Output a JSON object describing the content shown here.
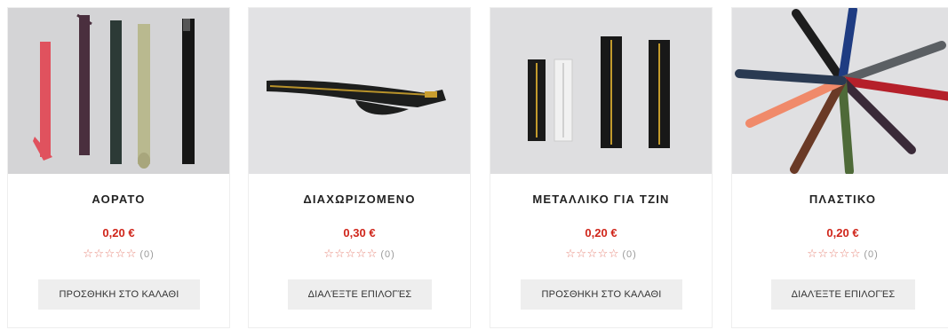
{
  "products": [
    {
      "title": "ΑΟΡΑΤΟ",
      "price": "0,20 €",
      "stars": "☆☆☆☆☆",
      "rating_count": "(0)",
      "button_label": "ΠΡΟΣΘΗΚΗ ΣΤΟ ΚΑΛΑΘΙ"
    },
    {
      "title": "ΔΙΑΧΩΡΙΖΟΜΕΝΟ",
      "price": "0,30 €",
      "stars": "☆☆☆☆☆",
      "rating_count": "(0)",
      "button_label": "ΔΙΑΛΈΞΤΕ ΕΠΙΛΟΓΈΣ"
    },
    {
      "title": "ΜΕΤΑΛΛΙΚΟ ΓΙΑ ΤΖΙΝ",
      "price": "0,20 €",
      "stars": "☆☆☆☆☆",
      "rating_count": "(0)",
      "button_label": "ΠΡΟΣΘΗΚΗ ΣΤΟ ΚΑΛΑΘΙ"
    },
    {
      "title": "ΠΛΑΣΤΙΚΟ",
      "price": "0,20 €",
      "stars": "☆☆☆☆☆",
      "rating_count": "(0)",
      "button_label": "ΔΙΑΛΈΞΤΕ ΕΠΙΛΟΓΈΣ"
    }
  ],
  "colors": {
    "price": "#d0261b",
    "stars": "#e7867a",
    "button_bg": "#eeeeee"
  }
}
